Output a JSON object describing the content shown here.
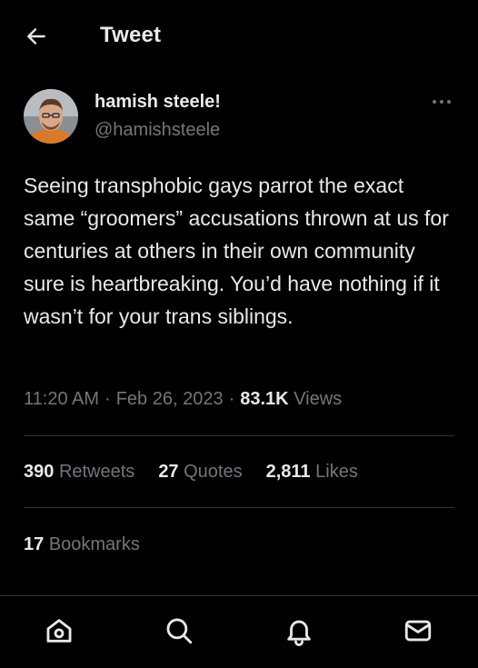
{
  "header": {
    "title": "Tweet",
    "back_icon": "arrow-left-icon"
  },
  "author": {
    "display_name": "hamish steele!",
    "handle": "@hamishsteele"
  },
  "tweet": {
    "text": "Seeing transphobic gays parrot the exact same “groomers” accusations thrown at us for centuries at others in their own community sure is heartbreaking. You’d have nothing if it wasn’t for your trans siblings.",
    "time": "11:20 AM",
    "separator": "·",
    "date": "Feb 26, 2023",
    "views_count": "83.1K",
    "views_label": "Views"
  },
  "stats": {
    "retweets_count": "390",
    "retweets_label": "Retweets",
    "quotes_count": "27",
    "quotes_label": "Quotes",
    "likes_count": "2,811",
    "likes_label": "Likes",
    "bookmarks_count": "17",
    "bookmarks_label": "Bookmarks"
  },
  "nav": {
    "items": [
      "home-icon",
      "search-icon",
      "notifications-bell-icon",
      "messages-envelope-icon"
    ]
  },
  "colors": {
    "background": "#000000",
    "primary_text": "#e7e9ea",
    "secondary_text": "#71767b",
    "divider": "#2f3336"
  }
}
